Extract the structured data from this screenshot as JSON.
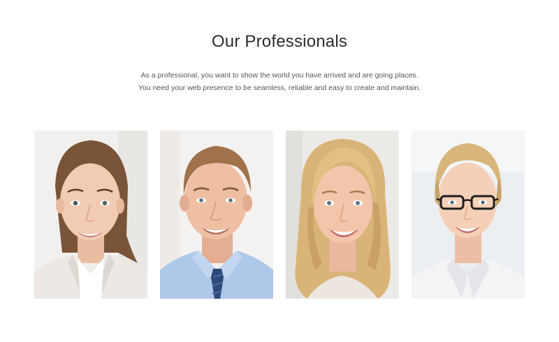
{
  "header": {
    "title": "Our Professionals",
    "subtitle_line1": "As a professional, you want to show the world you have arrived and are going places.",
    "subtitle_line2": "You need your web presence to be seamless, reliable and easy to create and maintain."
  },
  "team": {
    "members": [
      {
        "photo": "woman-brown-hair-white-jacket",
        "hair": "#7a5438",
        "skin": "#f1cbb3",
        "clothes": "#ece9e4",
        "bg": "#f2f0ee"
      },
      {
        "photo": "man-blue-shirt-tie",
        "hair": "#a0714a",
        "skin": "#eebfa3",
        "clothes": "#aec8ea",
        "bg": "#f4f2f0"
      },
      {
        "photo": "woman-blonde-smiling",
        "hair": "#d9b478",
        "skin": "#f3c6ab",
        "clothes": "#ece6de",
        "bg": "#eceae6"
      },
      {
        "photo": "woman-blonde-glasses",
        "hair": "#d8b57a",
        "skin": "#f5d0b8",
        "clothes": "#f4f4f6",
        "bg": "#eceff2"
      }
    ]
  }
}
